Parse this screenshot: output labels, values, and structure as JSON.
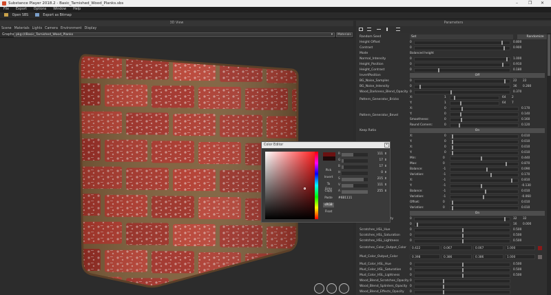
{
  "window": {
    "title": "Substance Player 2018.2 - Basic_Tarnished_Wood_Planks.sbs",
    "controls": [
      "–",
      "❐",
      "✕"
    ]
  },
  "menu": [
    "File",
    "Export",
    "Options",
    "Window",
    "Help"
  ],
  "toolbar": {
    "open_label": "Open SBS",
    "export_label": "Export as Bitmap"
  },
  "viewport": {
    "title": "3D View",
    "menus": [
      "Scene",
      "Materials",
      "Lights",
      "Camera",
      "Environment",
      "Display"
    ],
    "graph_label": "Graphs",
    "graph_path": "pkg:///Basic_Tarnished_Wood_Planks",
    "mode_label": "Materials"
  },
  "params": {
    "title": "Parameters",
    "toolbar_icons": [
      "grid-icon",
      "list-icon",
      "dash-icon",
      "pin-icon",
      "menu-icon"
    ],
    "rows": [
      {
        "label": "Random Seed",
        "type": "seed",
        "value": "Set",
        "extra": "Randomize"
      },
      {
        "label": "Height Offset",
        "type": "slider",
        "left": "0",
        "num": "0.800",
        "pos": 0.92
      },
      {
        "label": "Contrast",
        "type": "slider",
        "left": "0",
        "num": "0.900",
        "pos": 0.94
      },
      {
        "label": "Mode",
        "type": "text",
        "value": "Balanced height"
      },
      {
        "label": "Normal_Intensity",
        "type": "slider",
        "left": "0",
        "num": "1.000",
        "pos": 0.97
      },
      {
        "label": "Height_Position",
        "type": "slider",
        "left": "0",
        "num": "0.910",
        "pos": 0.93
      },
      {
        "label": "Height_Contrast",
        "type": "slider",
        "left": "0",
        "num": "0.180",
        "pos": 0.25
      },
      {
        "label": "InvertPosition",
        "type": "toggle",
        "value": "Off"
      },
      {
        "label": "BG_Noise_Samples",
        "type": "slider",
        "left": "0",
        "num": "22",
        "num2": "22",
        "pos": 0.95
      },
      {
        "label": "BG_Noise_Intensity",
        "type": "slider",
        "left": "0",
        "num": "36",
        "num2": "0.280",
        "pos": 0.05
      },
      {
        "label": "Wood_Darkness_Blend_Opacity",
        "type": "slider",
        "left": "0",
        "num": "0.370",
        "pos": 0.38
      }
    ],
    "bricks_label": "Pattern_Generator_Bricks",
    "bricks": [
      {
        "axis": "X:",
        "left": "1",
        "num": "64",
        "num2": "2"
      },
      {
        "axis": "Y:",
        "left": "1",
        "num": "64",
        "num2": "7"
      }
    ],
    "bevel_label": "Pattern_Generator_Bevel",
    "bevel": [
      {
        "axis": "X:",
        "left": "0",
        "num": "0.170"
      },
      {
        "axis": "Y:",
        "left": "0",
        "num": "0.140"
      },
      {
        "axis": "Smoothness:",
        "left": "0",
        "num": "0.160"
      },
      {
        "axis": "Round Corners:",
        "left": "0",
        "num": "0.120"
      }
    ],
    "keep_ratio_label": "Keep Ratio",
    "keep_ratio_value": "On",
    "offset_rows": [
      {
        "axis": "X:",
        "left": "0",
        "num": "0.010"
      },
      {
        "axis": "Y:",
        "left": "0",
        "num": "0.010"
      },
      {
        "axis": "X:",
        "left": "0",
        "num": "0.010"
      },
      {
        "axis": "Y:",
        "left": "0",
        "num": "0.010"
      }
    ],
    "height_label": "ight",
    "height_rows": [
      {
        "axis": "Min:",
        "left": "0",
        "num": "0.440"
      },
      {
        "axis": "Max:",
        "left": "0",
        "num": "0.870"
      },
      {
        "axis": "Balance:",
        "left": "-1",
        "num": "0.090"
      },
      {
        "axis": "Variation:",
        "left": "-1",
        "num": "0.170"
      },
      {
        "axis": "X:",
        "left": "-1",
        "num": "0.810"
      },
      {
        "axis": "Y:",
        "left": "-1",
        "num": "-0.130"
      },
      {
        "axis": "Balance:",
        "left": "-1",
        "num": "0.010"
      },
      {
        "axis": "Variation:",
        "left": "-1",
        "num": "-0.060"
      }
    ],
    "offset_label": "ffset",
    "offset2_rows": [
      {
        "axis": "Offset:",
        "left": "0",
        "num": "0.010"
      },
      {
        "axis": "Variation:",
        "left": "0",
        "num": "0.010"
      }
    ],
    "on_label": "On",
    "tail_rows": [
      {
        "label": "Wood_Noise_Intensity",
        "left": "0",
        "num": "32",
        "num2": "32",
        "pos": 0.95
      },
      {
        "label": "",
        "left": "0",
        "num": "16",
        "num2": "0.000",
        "pos": 0.02
      },
      {
        "label": "Scratches_HSL_Hue",
        "left": "0",
        "num": "0.500",
        "pos": 0.5
      },
      {
        "label": "Scratches_HSL_Saturation",
        "left": "0",
        "num": "0.500",
        "pos": 0.5
      },
      {
        "label": "Scratches_HSL_Lightness",
        "left": "0",
        "num": "0.500",
        "pos": 0.5
      }
    ],
    "scratch_color_label": "Scratches_Color_Output_Color",
    "scratch_color_values": [
      "0.422",
      "0.067",
      "0.067",
      "1.000"
    ],
    "mud_color_label": "Mud_Color_Output_Color",
    "mud_color_values": [
      "0.398",
      "0.386",
      "0.386",
      "1.000"
    ],
    "tail2_rows": [
      {
        "label": "Mud_Color_HSL_Hue",
        "left": "0",
        "num": "0.500",
        "pos": 0.5
      },
      {
        "label": "Mud_Color_HSL_Saturation",
        "left": "0",
        "num": "0.500",
        "pos": 0.5
      },
      {
        "label": "Mud_Color_HSL_Lightness",
        "left": "0",
        "num": "0.500",
        "pos": 0.5
      },
      {
        "label": "Wood_Blend_Scratches_Opacity",
        "left": "0",
        "num": "",
        "pos": 0.3
      },
      {
        "label": "Wood_Blend_Splinters_Opacity",
        "left": "0",
        "num": "",
        "pos": 0.3
      },
      {
        "label": "Wood_Blend_Effects_Opacity",
        "left": "0",
        "num": "",
        "pos": 0.3
      }
    ]
  },
  "picker": {
    "title": "Color Editor",
    "close": "×",
    "current_color": "#6b1111",
    "old_color": "#1e0a0a",
    "channels": [
      {
        "label": "R",
        "value": "111",
        "fill": 0.44
      },
      {
        "label": "G",
        "value": "17",
        "fill": 0.07
      },
      {
        "label": "B",
        "value": "17",
        "fill": 0.07
      },
      {
        "label": "H",
        "value": "0",
        "fill": 0.0
      },
      {
        "label": "S",
        "value": "215",
        "fill": 0.84
      },
      {
        "label": "V",
        "value": "111",
        "fill": 0.44
      },
      {
        "label": "A",
        "value": "255",
        "fill": 1.0
      }
    ],
    "hex": "#6B1111",
    "buttons": [
      "Pick",
      "Invert",
      "To Grey",
      "Copy",
      "Paste",
      "sRGB",
      "Float"
    ],
    "selected_button": "sRGB"
  }
}
